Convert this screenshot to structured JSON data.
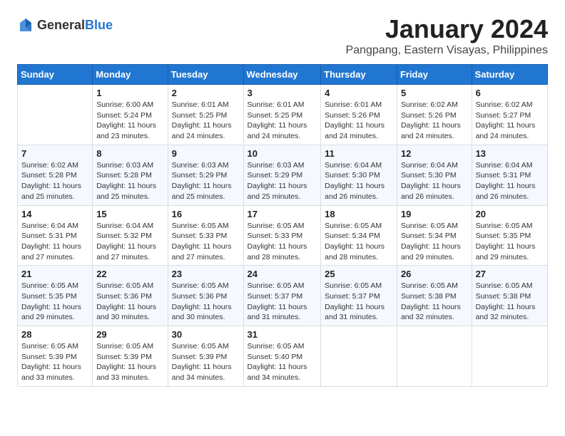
{
  "header": {
    "logo_general": "General",
    "logo_blue": "Blue",
    "month": "January 2024",
    "location": "Pangpang, Eastern Visayas, Philippines"
  },
  "columns": [
    "Sunday",
    "Monday",
    "Tuesday",
    "Wednesday",
    "Thursday",
    "Friday",
    "Saturday"
  ],
  "weeks": [
    [
      {
        "day": "",
        "sunrise": "",
        "sunset": "",
        "daylight": ""
      },
      {
        "day": "1",
        "sunrise": "6:00 AM",
        "sunset": "5:24 PM",
        "daylight": "11 hours and 23 minutes."
      },
      {
        "day": "2",
        "sunrise": "6:01 AM",
        "sunset": "5:25 PM",
        "daylight": "11 hours and 24 minutes."
      },
      {
        "day": "3",
        "sunrise": "6:01 AM",
        "sunset": "5:25 PM",
        "daylight": "11 hours and 24 minutes."
      },
      {
        "day": "4",
        "sunrise": "6:01 AM",
        "sunset": "5:26 PM",
        "daylight": "11 hours and 24 minutes."
      },
      {
        "day": "5",
        "sunrise": "6:02 AM",
        "sunset": "5:26 PM",
        "daylight": "11 hours and 24 minutes."
      },
      {
        "day": "6",
        "sunrise": "6:02 AM",
        "sunset": "5:27 PM",
        "daylight": "11 hours and 24 minutes."
      }
    ],
    [
      {
        "day": "7",
        "sunrise": "6:02 AM",
        "sunset": "5:28 PM",
        "daylight": "11 hours and 25 minutes."
      },
      {
        "day": "8",
        "sunrise": "6:03 AM",
        "sunset": "5:28 PM",
        "daylight": "11 hours and 25 minutes."
      },
      {
        "day": "9",
        "sunrise": "6:03 AM",
        "sunset": "5:29 PM",
        "daylight": "11 hours and 25 minutes."
      },
      {
        "day": "10",
        "sunrise": "6:03 AM",
        "sunset": "5:29 PM",
        "daylight": "11 hours and 25 minutes."
      },
      {
        "day": "11",
        "sunrise": "6:04 AM",
        "sunset": "5:30 PM",
        "daylight": "11 hours and 26 minutes."
      },
      {
        "day": "12",
        "sunrise": "6:04 AM",
        "sunset": "5:30 PM",
        "daylight": "11 hours and 26 minutes."
      },
      {
        "day": "13",
        "sunrise": "6:04 AM",
        "sunset": "5:31 PM",
        "daylight": "11 hours and 26 minutes."
      }
    ],
    [
      {
        "day": "14",
        "sunrise": "6:04 AM",
        "sunset": "5:31 PM",
        "daylight": "11 hours and 27 minutes."
      },
      {
        "day": "15",
        "sunrise": "6:04 AM",
        "sunset": "5:32 PM",
        "daylight": "11 hours and 27 minutes."
      },
      {
        "day": "16",
        "sunrise": "6:05 AM",
        "sunset": "5:33 PM",
        "daylight": "11 hours and 27 minutes."
      },
      {
        "day": "17",
        "sunrise": "6:05 AM",
        "sunset": "5:33 PM",
        "daylight": "11 hours and 28 minutes."
      },
      {
        "day": "18",
        "sunrise": "6:05 AM",
        "sunset": "5:34 PM",
        "daylight": "11 hours and 28 minutes."
      },
      {
        "day": "19",
        "sunrise": "6:05 AM",
        "sunset": "5:34 PM",
        "daylight": "11 hours and 29 minutes."
      },
      {
        "day": "20",
        "sunrise": "6:05 AM",
        "sunset": "5:35 PM",
        "daylight": "11 hours and 29 minutes."
      }
    ],
    [
      {
        "day": "21",
        "sunrise": "6:05 AM",
        "sunset": "5:35 PM",
        "daylight": "11 hours and 29 minutes."
      },
      {
        "day": "22",
        "sunrise": "6:05 AM",
        "sunset": "5:36 PM",
        "daylight": "11 hours and 30 minutes."
      },
      {
        "day": "23",
        "sunrise": "6:05 AM",
        "sunset": "5:36 PM",
        "daylight": "11 hours and 30 minutes."
      },
      {
        "day": "24",
        "sunrise": "6:05 AM",
        "sunset": "5:37 PM",
        "daylight": "11 hours and 31 minutes."
      },
      {
        "day": "25",
        "sunrise": "6:05 AM",
        "sunset": "5:37 PM",
        "daylight": "11 hours and 31 minutes."
      },
      {
        "day": "26",
        "sunrise": "6:05 AM",
        "sunset": "5:38 PM",
        "daylight": "11 hours and 32 minutes."
      },
      {
        "day": "27",
        "sunrise": "6:05 AM",
        "sunset": "5:38 PM",
        "daylight": "11 hours and 32 minutes."
      }
    ],
    [
      {
        "day": "28",
        "sunrise": "6:05 AM",
        "sunset": "5:39 PM",
        "daylight": "11 hours and 33 minutes."
      },
      {
        "day": "29",
        "sunrise": "6:05 AM",
        "sunset": "5:39 PM",
        "daylight": "11 hours and 33 minutes."
      },
      {
        "day": "30",
        "sunrise": "6:05 AM",
        "sunset": "5:39 PM",
        "daylight": "11 hours and 34 minutes."
      },
      {
        "day": "31",
        "sunrise": "6:05 AM",
        "sunset": "5:40 PM",
        "daylight": "11 hours and 34 minutes."
      },
      {
        "day": "",
        "sunrise": "",
        "sunset": "",
        "daylight": ""
      },
      {
        "day": "",
        "sunrise": "",
        "sunset": "",
        "daylight": ""
      },
      {
        "day": "",
        "sunrise": "",
        "sunset": "",
        "daylight": ""
      }
    ]
  ]
}
